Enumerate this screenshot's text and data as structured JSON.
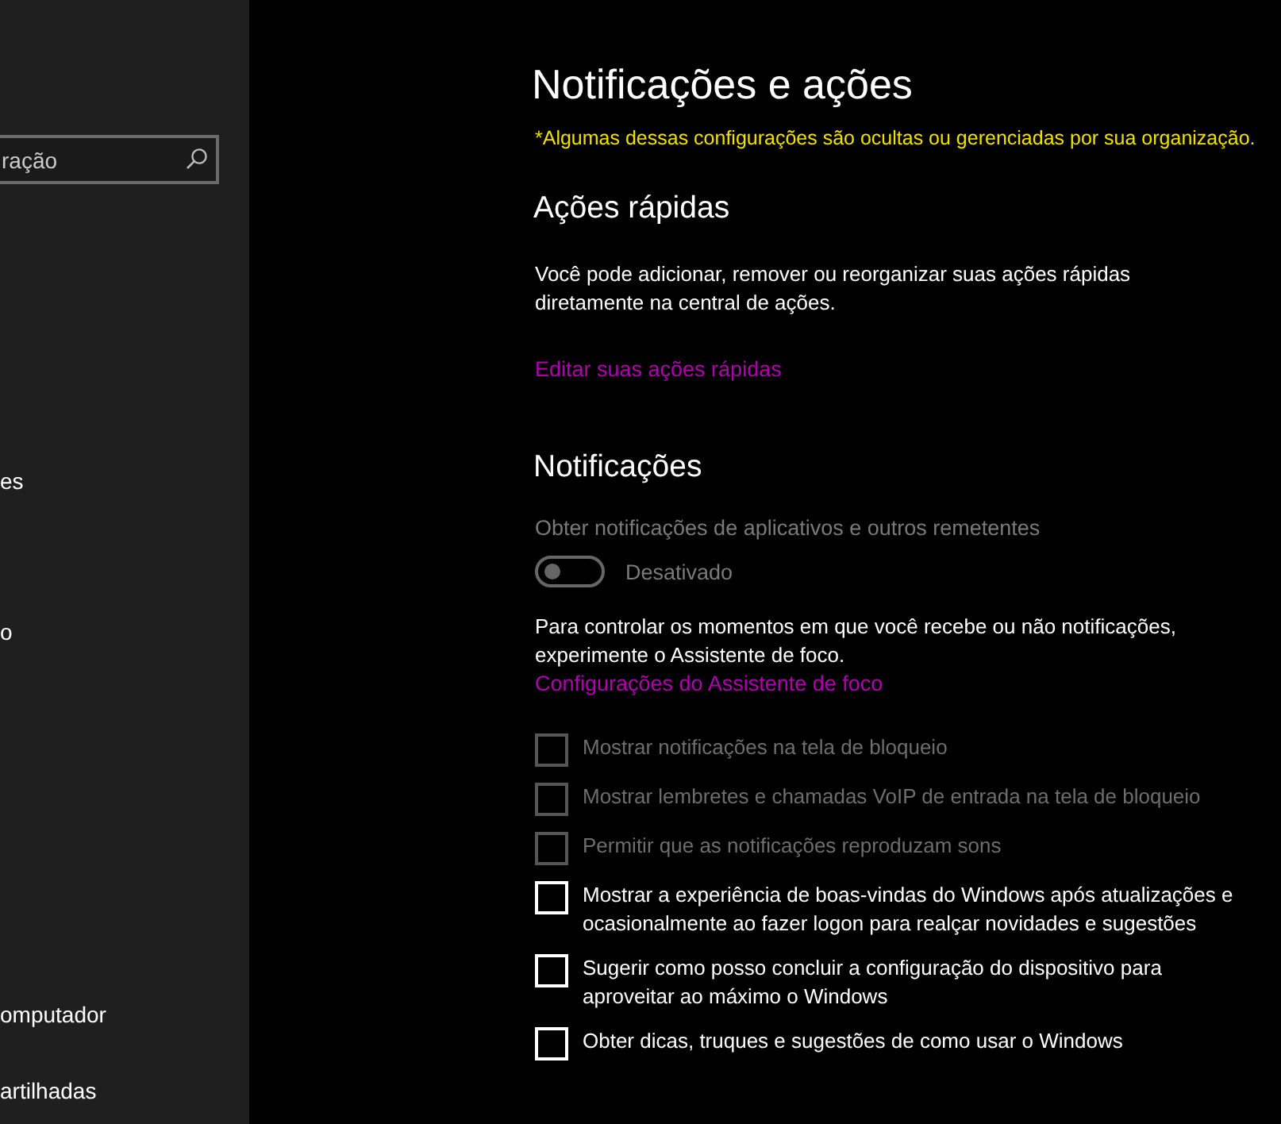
{
  "sidebar": {
    "search": {
      "value": "ração"
    },
    "items": [
      {
        "label": "es"
      },
      {
        "label": "o"
      },
      {
        "label": "omputador"
      },
      {
        "label": "artilhadas"
      }
    ]
  },
  "page": {
    "title": "Notificações e ações",
    "managed_notice": "*Algumas dessas configurações são ocultas ou gerenciadas por sua organização.",
    "quick_actions": {
      "heading": "Ações rápidas",
      "description": "Você pode adicionar, remover ou reorganizar suas ações rápidas diretamente na central de ações.",
      "link": "Editar suas ações rápidas"
    },
    "notifications": {
      "heading": "Notificações",
      "toggle": {
        "label": "Obter notificações de aplicativos e outros remetentes",
        "state_text": "Desativado",
        "on": false,
        "disabled": true
      },
      "focus_text": "Para controlar os momentos em que você recebe ou não notificações, experimente o Assistente de foco.",
      "focus_link": "Configurações do Assistente de foco",
      "checkboxes": [
        {
          "label": "Mostrar notificações na tela de bloqueio",
          "checked": false,
          "disabled": true
        },
        {
          "label": "Mostrar lembretes e chamadas VoIP de entrada na tela de bloqueio",
          "checked": false,
          "disabled": true
        },
        {
          "label": "Permitir que as notificações reproduzam sons",
          "checked": false,
          "disabled": true
        },
        {
          "label": "Mostrar a experiência de boas-vindas do Windows após atualizações e ocasionalmente ao fazer logon para realçar novidades e sugestões",
          "checked": false,
          "disabled": false
        },
        {
          "label": "Sugerir como posso concluir a configuração do dispositivo para aproveitar ao máximo o Windows",
          "checked": false,
          "disabled": false
        },
        {
          "label": "Obter dicas, truques e sugestões de como usar o Windows",
          "checked": false,
          "disabled": false
        }
      ]
    }
  }
}
